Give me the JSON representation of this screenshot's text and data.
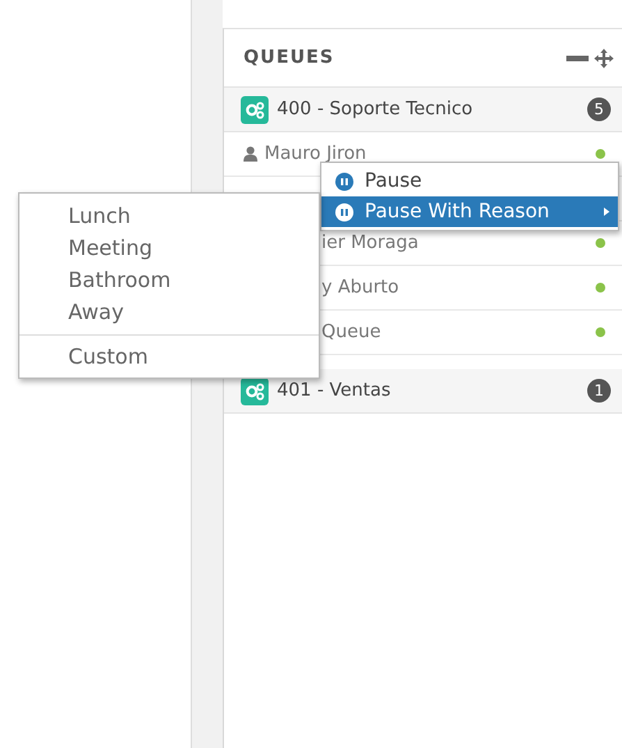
{
  "panel": {
    "title": "QUEUES"
  },
  "queues": [
    {
      "name": "400 - Soporte Tecnico",
      "count": "5",
      "members": [
        {
          "name": "Mauro Jiron",
          "kind": "full",
          "online": true
        },
        {
          "name": "ier Moraga",
          "kind": "cut",
          "online": true
        },
        {
          "name": "y Aburto",
          "kind": "cut",
          "online": true
        },
        {
          "name": "Queue",
          "kind": "cut",
          "online": true
        }
      ]
    },
    {
      "name": "401 - Ventas",
      "count": "1"
    }
  ],
  "menu": [
    {
      "label": "Pause",
      "selected": false,
      "submenu": false
    },
    {
      "label": "Pause With Reason",
      "selected": true,
      "submenu": true
    }
  ],
  "submenu": {
    "items": [
      "Lunch",
      "Meeting",
      "Bathroom",
      "Away"
    ],
    "custom": "Custom"
  }
}
